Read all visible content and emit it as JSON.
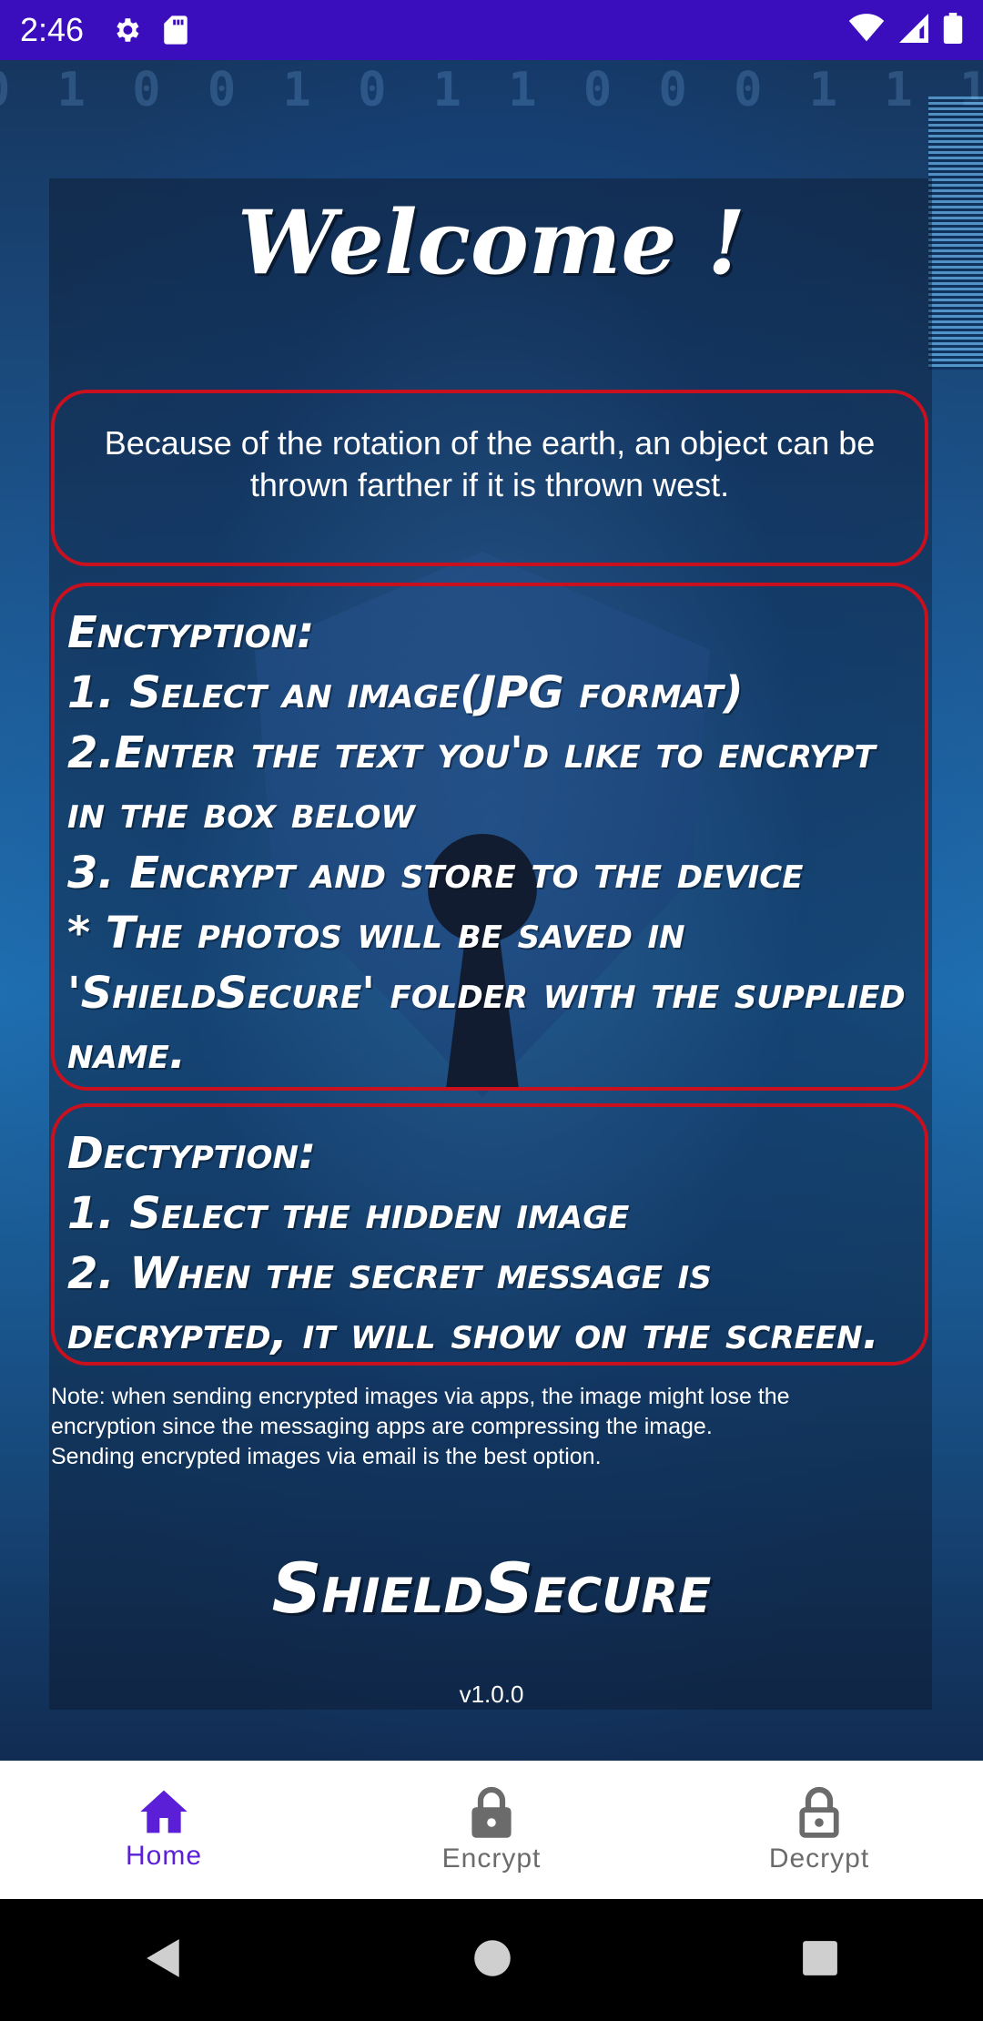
{
  "status_bar": {
    "time": "2:46"
  },
  "welcome_title": "Welcome !",
  "fact_text": "Because of the rotation of the earth, an object can be thrown farther if it is thrown west.",
  "encryption": {
    "line1": "Enctyption:",
    "line2": "1. Select an image(JPG format)",
    "line3": "2.Enter the text you'd like to encrypt",
    "line4": "in the box below",
    "line5": "3. Encrypt and store to the device",
    "line6": "* The photos will be saved in",
    "line7": "'ShieldSecure' folder with the supplied",
    "line8": "name."
  },
  "decryption": {
    "line1": "Dectyption:",
    "line2": "1. Select the hidden image",
    "line3": "2. When the secret message is",
    "line4": "decrypted, it will show on the screen."
  },
  "note": {
    "line1": "Note: when sending encrypted images via  apps, the image might lose the",
    "line2": "encryption since the messaging apps are compressing the image.",
    "line3": "Sending encrypted images via email is the best option."
  },
  "brand": "ShieldSecure",
  "version": "v1.0.0",
  "bottom_nav": {
    "active_color": "#5a1fd6",
    "items": [
      {
        "label": "Home",
        "icon": "home-icon",
        "active": true
      },
      {
        "label": "Encrypt",
        "icon": "lock-icon",
        "active": false
      },
      {
        "label": "Decrypt",
        "icon": "unlock-icon",
        "active": false
      }
    ]
  }
}
